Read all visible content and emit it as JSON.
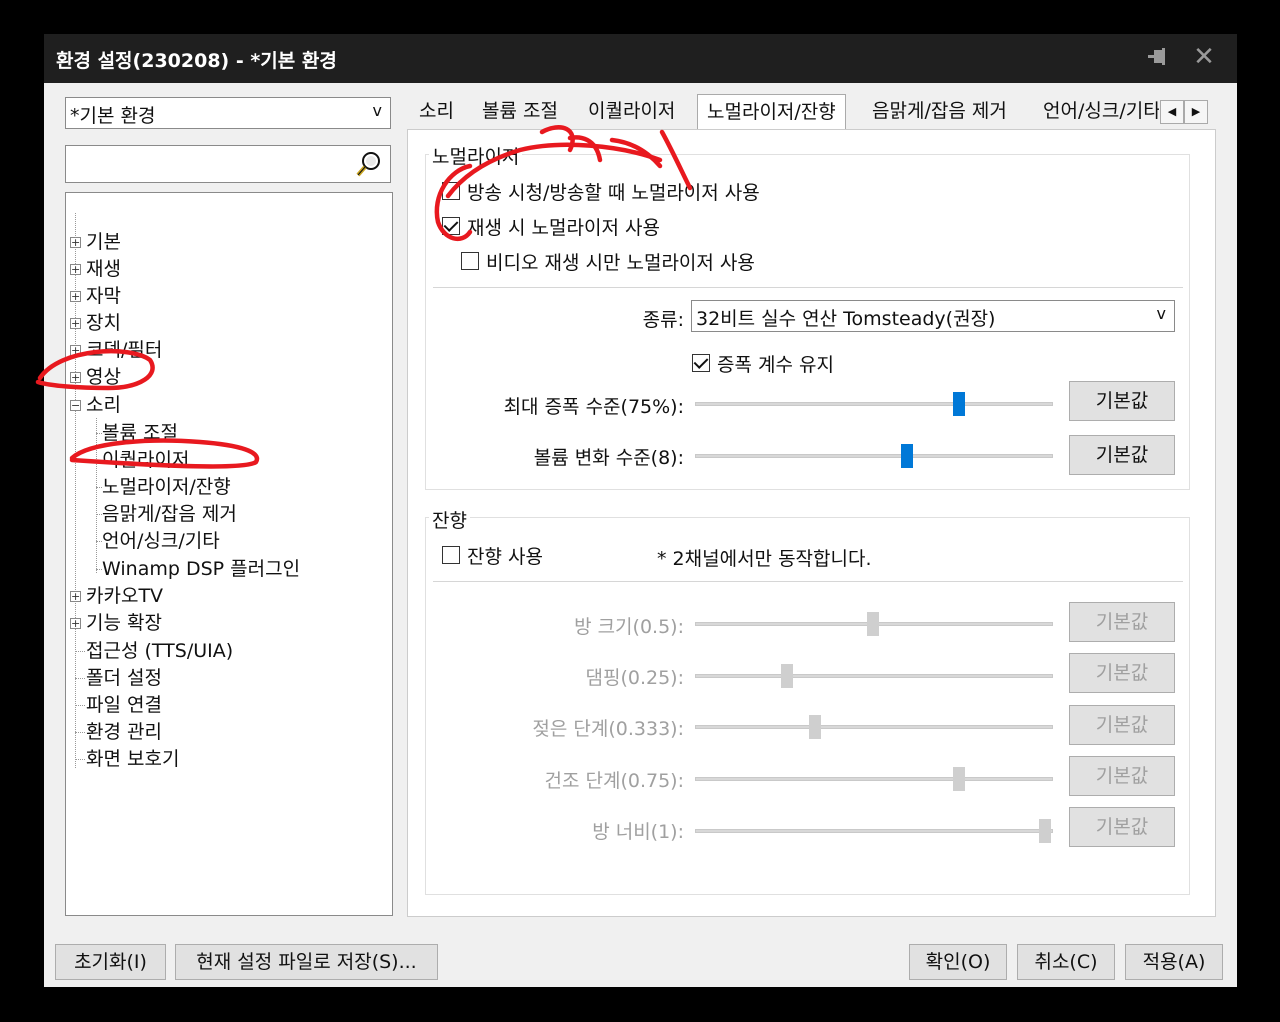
{
  "window": {
    "title": "환경 설정(230208) - *기본 환경",
    "pin_icon": "pin-icon",
    "close_icon": "close-icon"
  },
  "left": {
    "preset": "*기본 환경",
    "dropdown_arrow": "v",
    "search_icon": "magnifier-icon",
    "tree": [
      {
        "label": "기본",
        "expander": "+"
      },
      {
        "label": "재생",
        "expander": "+"
      },
      {
        "label": "자막",
        "expander": "+"
      },
      {
        "label": "장치",
        "expander": "+"
      },
      {
        "label": "코덱/필터",
        "expander": "+"
      },
      {
        "label": "영상",
        "expander": "+"
      },
      {
        "label": "소리",
        "expander": "−"
      },
      {
        "label": "볼륨 조절"
      },
      {
        "label": "이퀄라이저"
      },
      {
        "label": "노멀라이저/잔향"
      },
      {
        "label": "음맑게/잡음 제거"
      },
      {
        "label": "언어/싱크/기타"
      },
      {
        "label": "Winamp DSP 플러그인"
      },
      {
        "label": "카카오TV",
        "expander": "+"
      },
      {
        "label": "기능 확장",
        "expander": "+"
      },
      {
        "label": "접근성 (TTS/UIA)"
      },
      {
        "label": "폴더 설정"
      },
      {
        "label": "파일 연결"
      },
      {
        "label": "환경 관리"
      },
      {
        "label": "화면 보호기"
      }
    ]
  },
  "tabs": [
    "소리",
    "볼륨 조절",
    "이퀄라이저",
    "노멀라이저/잔향",
    "음맑게/잡음 제거",
    "언어/싱크/기타"
  ],
  "tab_scroll": {
    "left": "◀",
    "right": "▶"
  },
  "normalizer": {
    "group_label": "노멀라이저",
    "cb_broadcast": "방송 시청/방송할 때 노멀라이저 사용",
    "cb_playback": "재생 시 노멀라이저 사용",
    "cb_video_only": "비디오 재생 시만 노멀라이저 사용",
    "type_label": "종류:",
    "type_value": "32비트 실수 연산 Tomsteady(권장)",
    "type_arrow": "v",
    "cb_keep_gain": "증폭 계수 유지",
    "max_gain_label": "최대 증폭 수준(75%):",
    "max_gain_value": 75,
    "vol_change_label": "볼륨 변화 수준(8):",
    "vol_change_value": 8,
    "default_btn": "기본값"
  },
  "reverb": {
    "group_label": "잔향",
    "cb_use": "잔향 사용",
    "note": "* 2채널에서만 동작합니다.",
    "rows": [
      {
        "label": "방 크기(0.5):",
        "value": 0.5,
        "btn": "기본값"
      },
      {
        "label": "댐핑(0.25):",
        "value": 0.25,
        "btn": "기본값"
      },
      {
        "label": "젖은 단계(0.333):",
        "value": 0.333,
        "btn": "기본값"
      },
      {
        "label": "건조 단계(0.75):",
        "value": 0.75,
        "btn": "기본값"
      },
      {
        "label": "방 너비(1):",
        "value": 1,
        "btn": "기본값"
      }
    ]
  },
  "footer": {
    "reset": "초기화(I)",
    "save_to_file": "현재 설정 파일로 저장(S)...",
    "ok": "확인(O)",
    "cancel": "취소(C)",
    "apply": "적용(A)"
  },
  "colors": {
    "accent": "#0078d7",
    "annotation": "#e8191f",
    "titlebar": "#1f1f1f"
  }
}
